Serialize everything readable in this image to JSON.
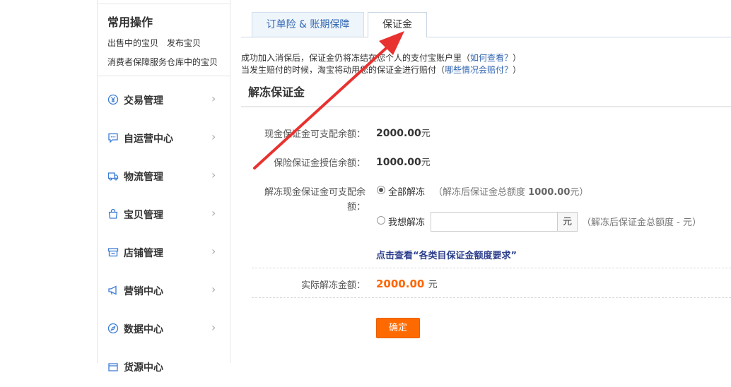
{
  "sidebar": {
    "common_title": "常用操作",
    "quick_links": [
      "出售中的宝贝",
      "发布宝贝",
      "消费者保障服务",
      "仓库中的宝贝"
    ],
    "items": [
      {
        "label": "交易管理",
        "icon": "yen-circle-icon"
      },
      {
        "label": "自运营中心",
        "icon": "chat-bubble-icon"
      },
      {
        "label": "物流管理",
        "icon": "truck-icon"
      },
      {
        "label": "宝贝管理",
        "icon": "bag-icon"
      },
      {
        "label": "店铺管理",
        "icon": "storefront-icon"
      },
      {
        "label": "营销中心",
        "icon": "megaphone-icon"
      },
      {
        "label": "数据中心",
        "icon": "compass-icon"
      },
      {
        "label": "货源中心",
        "icon": "box-icon"
      }
    ]
  },
  "tabs": [
    {
      "label": "订单险 & 账期保障"
    },
    {
      "label": "保证金"
    }
  ],
  "notice": {
    "line1_text": "成功加入消保后，保证金仍将冻结在您个人的支付宝账户里（",
    "line1_link": "如何查看？",
    "line1_end": "）",
    "line2_text": "当发生赔付的时候，淘宝将动用您的保证金进行赔付（",
    "line2_link": "哪些情况会赔付？",
    "line2_end": "）"
  },
  "section_title": "解冻保证金",
  "form": {
    "cash_available_label": "现金保证金可支配余额：",
    "cash_available_value": "2000.00",
    "cash_available_unit": "元",
    "insurance_credit_label": "保险保证金授信余额：",
    "insurance_credit_value": "1000.00",
    "insurance_credit_unit": "元",
    "unfreeze_label_line1": "解冻现金保证金可支配余",
    "unfreeze_label_line2": "额：",
    "option_all_label": "全部解冻",
    "option_all_hint_prefix": "（解冻后保证金总额度",
    "option_all_hint_value": "1000.00",
    "option_all_hint_suffix": "元）",
    "option_custom_label": "我想解冻",
    "amount_input_value": "",
    "amount_unit": "元",
    "option_custom_hint": "（解冻后保证金总额度 - 元）",
    "requirement_link": "点击查看“各类目保证金额度要求”",
    "actual_label": "实际解冻金额：",
    "actual_value": "2000.00",
    "actual_unit": "元",
    "confirm_label": "确定",
    "selected_option": "all"
  },
  "colors": {
    "accent_orange": "#ff6a00",
    "link_blue": "#3266b1",
    "annotation_red": "#e8322f"
  }
}
